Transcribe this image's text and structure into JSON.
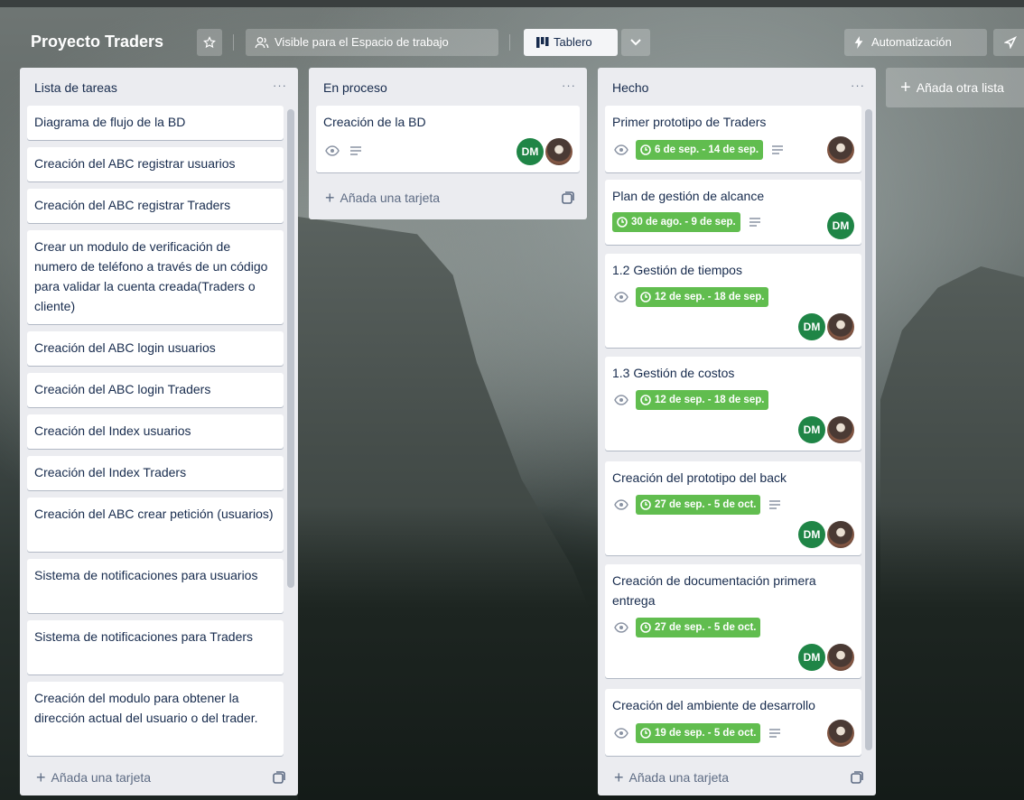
{
  "header": {
    "board_title": "Proyecto Traders",
    "visibility_label": "Visible para el Espacio de trabajo",
    "view_label": "Tablero",
    "automation_label": "Automatización"
  },
  "add_list_label": "Añada otra lista",
  "colors": {
    "due_green": "#61bd4f",
    "member_green": "#1f8546",
    "list_bg": "#ebecf0"
  },
  "lists": [
    {
      "title": "Lista de tareas",
      "menu": "···",
      "add_card": "Añada una tarjeta",
      "cards": [
        {
          "text": "Diagrama de flujo de la BD"
        },
        {
          "text": "Creación del ABC registrar usuarios"
        },
        {
          "text": "Creación del ABC registrar Traders"
        },
        {
          "text": "Crear un modulo de verificación de numero de teléfono a través de un código para validar la cuenta creada(Traders o cliente)"
        },
        {
          "text": "Creación del ABC login usuarios"
        },
        {
          "text": "Creación del ABC login Traders"
        },
        {
          "text": "Creación del Index usuarios"
        },
        {
          "text": "Creación del Index Traders"
        },
        {
          "text": "Creación del ABC crear petición (usuarios)"
        },
        {
          "text": "Sistema de notificaciones para usuarios"
        },
        {
          "text": "Sistema de notificaciones para Traders"
        },
        {
          "text": "Creación del modulo para obtener la dirección actual del usuario o del trader."
        }
      ]
    },
    {
      "title": "En proceso",
      "menu": "···",
      "add_card": "Añada una tarjeta",
      "cards": [
        {
          "text": "Creación de la BD",
          "members": [
            "DM",
            "photo"
          ]
        }
      ]
    },
    {
      "title": "Hecho",
      "menu": "···",
      "add_card": "Añada una tarjeta",
      "cards": [
        {
          "text": "Primer prototipo de Traders",
          "due": "6 de sep. - 14 de sep.",
          "members": [
            "photo"
          ]
        },
        {
          "text": "Plan de gestión de alcance",
          "due": "30 de ago. - 9 de sep.",
          "members": [
            "DM"
          ]
        },
        {
          "text": "1.2 Gestión de tiempos",
          "due": "12 de sep. - 18 de sep.",
          "members": [
            "DM",
            "photo"
          ]
        },
        {
          "text": "1.3 Gestión de costos",
          "due": "12 de sep. - 18 de sep.",
          "members": [
            "DM",
            "photo"
          ]
        },
        {
          "text": "Creación del prototipo del back",
          "due": "27 de sep. - 5 de oct.",
          "members": [
            "DM",
            "photo"
          ]
        },
        {
          "text": "Creación de documentación primera entrega",
          "due": "27 de sep. - 5 de oct.",
          "members": [
            "DM",
            "photo"
          ]
        },
        {
          "text": "Creación del ambiente de desarrollo",
          "due": "19 de sep. - 5 de oct.",
          "members": [
            "photo"
          ]
        }
      ]
    }
  ]
}
